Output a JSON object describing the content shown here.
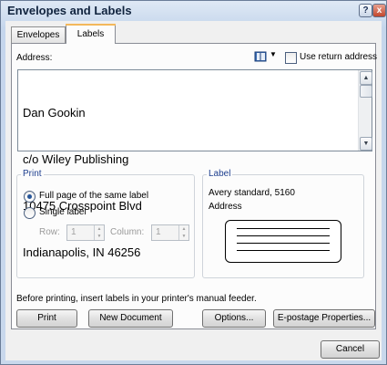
{
  "window": {
    "title": "Envelopes and Labels",
    "help_glyph": "?",
    "close_glyph": "x"
  },
  "tabs": [
    {
      "label": "Envelopes"
    },
    {
      "label": "Labels"
    }
  ],
  "address": {
    "label": "Address:",
    "lines": [
      "Dan Gookin",
      "c/o Wiley Publishing",
      "10475 Crosspoint Blvd",
      "Indianapolis, IN 46256"
    ],
    "use_return_address_label": "Use return address",
    "use_return_address_checked": false
  },
  "print_group": {
    "legend": "Print",
    "full_page_label": "Full page of the same label",
    "single_label_label": "Single label",
    "selected": "full_page",
    "row_label": "Row:",
    "row_value": "1",
    "column_label": "Column:",
    "column_value": "1"
  },
  "label_group": {
    "legend": "Label",
    "product": "Avery standard, 5160",
    "type": "Address"
  },
  "message": "Before printing, insert labels in your printer's manual feeder.",
  "buttons": {
    "print": "Print",
    "new_document": "New Document",
    "options": "Options...",
    "epostage": "E-postage Properties...",
    "cancel": "Cancel"
  },
  "icons": {
    "address_book": "address-book-icon",
    "dropdown": "chevron-down-icon"
  },
  "colors": {
    "group_legend": "#1e3f8f",
    "tab_highlight": "#f3b85b",
    "radio_dot": "#27569a"
  }
}
